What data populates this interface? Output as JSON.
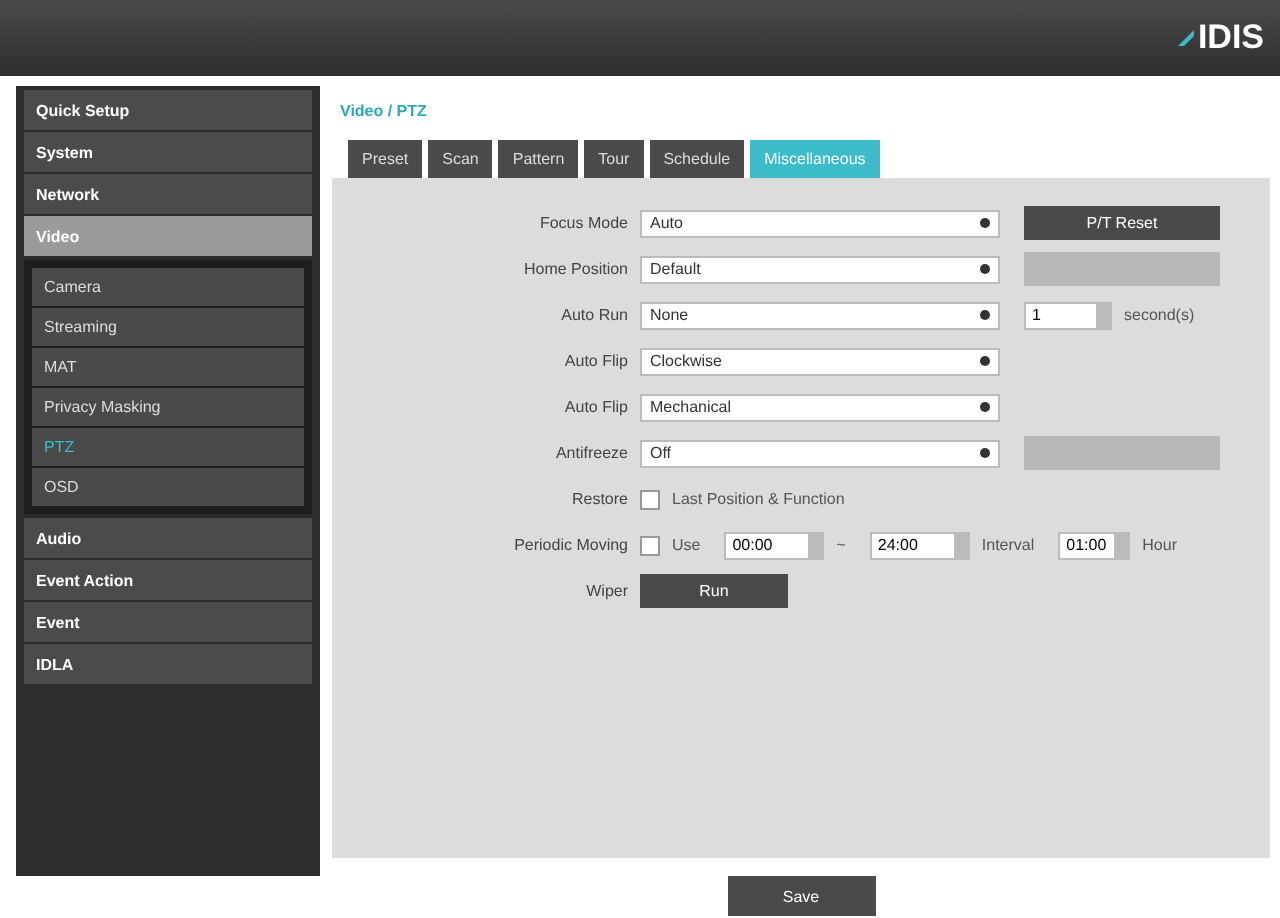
{
  "header": {
    "logo": "IDIS"
  },
  "sidebar": {
    "items": [
      {
        "label": "Quick Setup",
        "expanded": false
      },
      {
        "label": "System",
        "expanded": false
      },
      {
        "label": "Network",
        "expanded": false
      },
      {
        "label": "Video",
        "expanded": true,
        "children": [
          {
            "label": "Camera",
            "selected": false
          },
          {
            "label": "Streaming",
            "selected": false
          },
          {
            "label": "MAT",
            "selected": false
          },
          {
            "label": "Privacy Masking",
            "selected": false
          },
          {
            "label": "PTZ",
            "selected": true
          },
          {
            "label": "OSD",
            "selected": false
          }
        ]
      },
      {
        "label": "Audio",
        "expanded": false
      },
      {
        "label": "Event Action",
        "expanded": false
      },
      {
        "label": "Event",
        "expanded": false
      },
      {
        "label": "IDLA",
        "expanded": false
      }
    ]
  },
  "breadcrumb": "Video / PTZ",
  "tabs": [
    {
      "label": "Preset",
      "selected": false
    },
    {
      "label": "Scan",
      "selected": false
    },
    {
      "label": "Pattern",
      "selected": false
    },
    {
      "label": "Tour",
      "selected": false
    },
    {
      "label": "Schedule",
      "selected": false
    },
    {
      "label": "Miscellaneous",
      "selected": true
    }
  ],
  "rows": [
    {
      "kind": "select",
      "label": "Focus Mode",
      "value": "Auto",
      "button": {
        "label": "P/T Reset",
        "disabled": false
      }
    },
    {
      "kind": "select",
      "label": "Home Position",
      "value": "Default",
      "button": {
        "disabled": true
      }
    },
    {
      "kind": "select",
      "label": "Auto Run",
      "value": "None",
      "spin": {
        "value": "1",
        "unit": "second(s)"
      }
    },
    {
      "kind": "select",
      "label": "Auto Flip",
      "value": "Clockwise"
    },
    {
      "kind": "select",
      "label": "Auto Flip",
      "value": "Mechanical"
    },
    {
      "kind": "select",
      "label": "Antifreeze",
      "value": "Off",
      "button": {
        "disabled": true
      }
    },
    {
      "kind": "check",
      "label": "Restore",
      "checked": false,
      "text": "Last Position & Function"
    },
    {
      "kind": "periodic",
      "label": "Periodic Moving",
      "checked": false,
      "text": "Use",
      "start": "00:00",
      "sep": "~",
      "end": "24:00",
      "interval_label": "Interval",
      "interval": "01:00",
      "unit": "Hour"
    },
    {
      "kind": "action",
      "label": "Wiper",
      "button": {
        "label": "Run",
        "disabled": false
      }
    }
  ],
  "save": "Save"
}
